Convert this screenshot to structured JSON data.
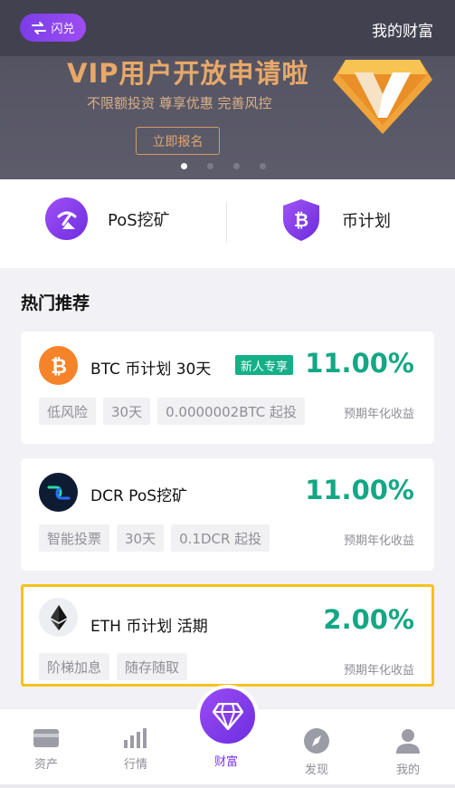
{
  "header": {
    "flash_label": "闪兑",
    "my_wealth": "我的财富"
  },
  "banner": {
    "title": "VIP用户开放申请啦",
    "subtitle": "不限额投资 尊享优惠 完善风控",
    "button": "立即报名",
    "slide_count": 4,
    "active_slide": 1
  },
  "quick_entries": [
    {
      "label": "PoS挖矿",
      "icon": "pickaxe-icon"
    },
    {
      "label": "币计划",
      "icon": "bitcoin-shield-icon"
    }
  ],
  "section": {
    "title": "热门推荐"
  },
  "products": [
    {
      "name": "BTC 币计划 30天",
      "badge": "新人专享",
      "rate": "11.00%",
      "rate_label": "预期年化收益",
      "tags": [
        "低风险",
        "30天",
        "0.0000002BTC 起投"
      ],
      "icon": "btc-icon",
      "icon_color": "#f5832a"
    },
    {
      "name": "DCR PoS挖矿",
      "rate": "11.00%",
      "rate_label": "预期年化收益",
      "tags": [
        "智能投票",
        "30天",
        "0.1DCR 起投"
      ],
      "icon": "dcr-icon",
      "icon_color": "#0e1c33"
    },
    {
      "name": "ETH 币计划 活期",
      "rate": "2.00%",
      "rate_label": "预期年化收益",
      "tags": [
        "阶梯加息",
        "随存随取"
      ],
      "icon": "eth-icon",
      "icon_color": "#eceef2"
    }
  ],
  "tabbar": [
    {
      "label": "资产",
      "icon": "wallet-icon"
    },
    {
      "label": "行情",
      "icon": "bar-chart-icon"
    },
    {
      "label": "财富",
      "icon": "diamond-icon",
      "active": true
    },
    {
      "label": "发现",
      "icon": "compass-icon"
    },
    {
      "label": "我的",
      "icon": "user-icon"
    }
  ],
  "colors": {
    "accent": "#7b3aea",
    "rate_green": "#13a785",
    "highlight_border": "#f5c21b",
    "banner_gold": "#e8a868"
  }
}
